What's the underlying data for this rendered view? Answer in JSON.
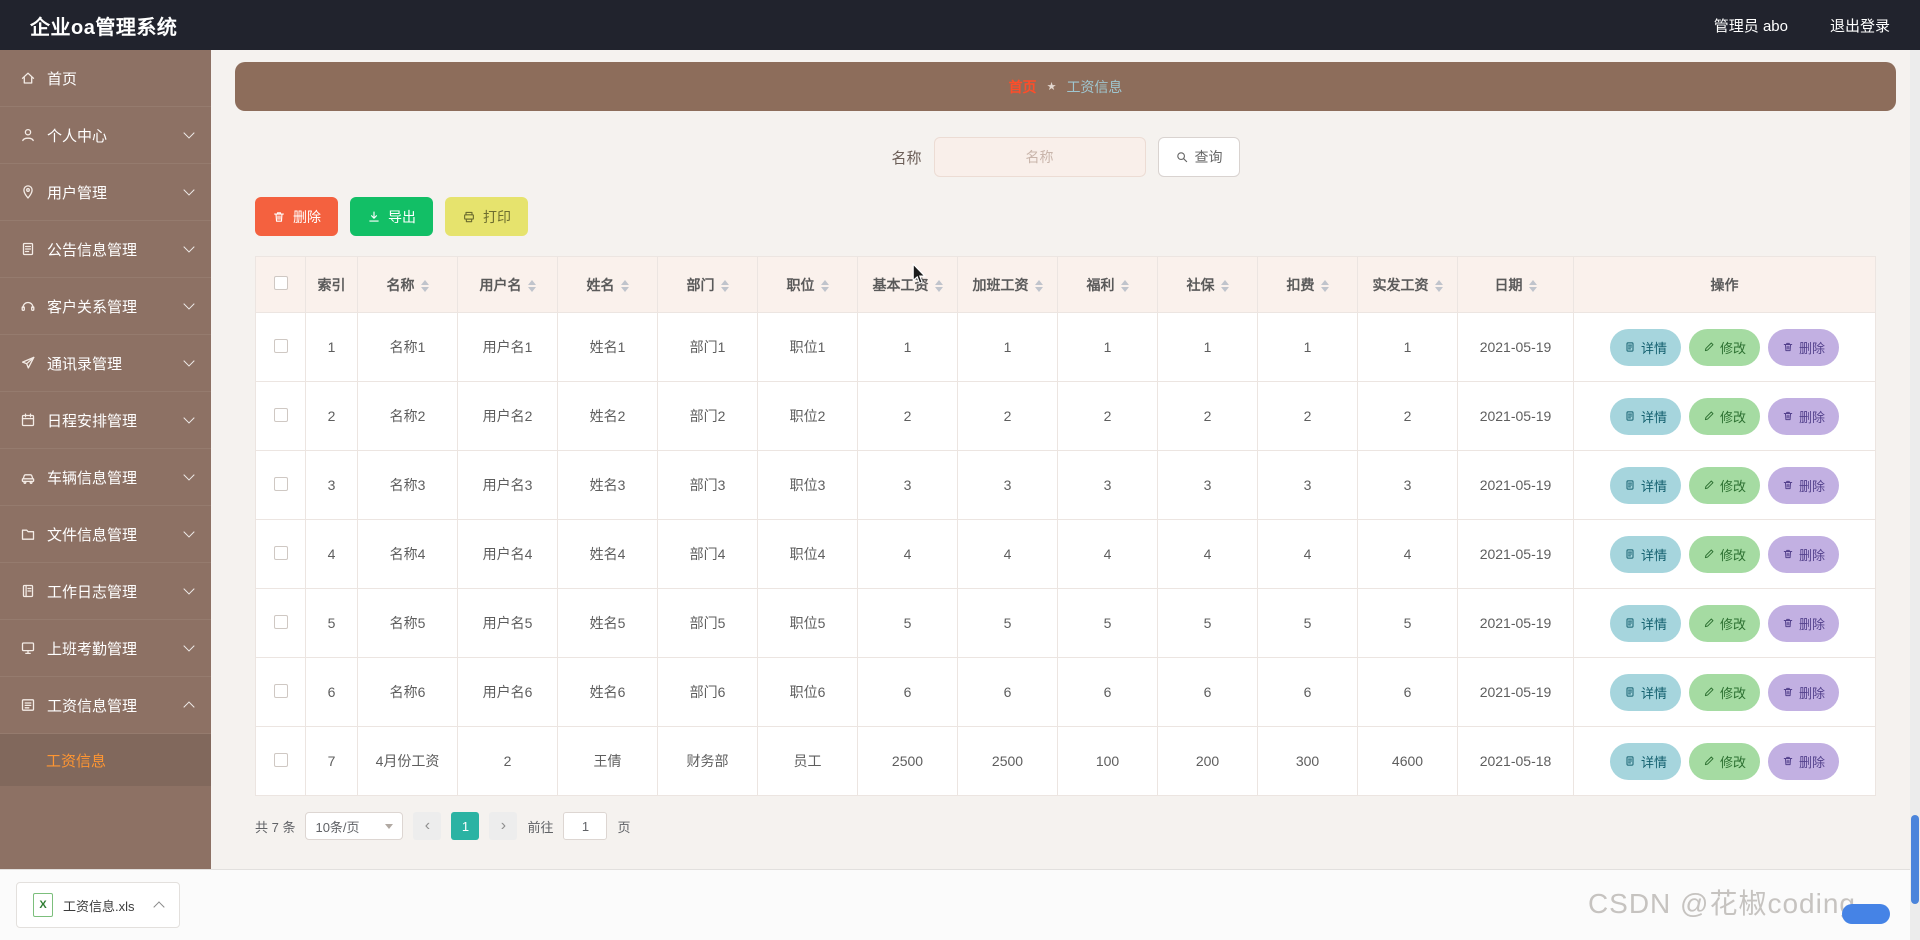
{
  "theme": {
    "header_bg": "#21232d",
    "sidebar_bg": "#8d7164",
    "submenu_active": "#ff9632",
    "breadcrumb_bg": "#8d6d5b",
    "breadcrumb_home": "#ff4d29",
    "breadcrumb_current": "#9fc6d0",
    "page_bg": "#f5f2ef",
    "table_header_bg": "#faf1ec",
    "table_border": "#ece5e1",
    "delete_btn": "#f4613f",
    "export_btn": "#12bf66",
    "print_btn_bg": "#e6e36d",
    "print_btn_text": "#6d6d2f",
    "detail_pill_bg": "#a6d5dd",
    "detail_pill_text": "#135f6e",
    "edit_pill_bg": "#a5dba2",
    "edit_pill_text": "#2c7031",
    "remove_pill_bg": "#c2b0e2",
    "remove_pill_text": "#53418c",
    "pagination_active": "#2bb3a3",
    "scrollbar_thumb": "#4a84db"
  },
  "header": {
    "title": "企业oa管理系统",
    "user": "管理员 abo",
    "logout": "退出登录"
  },
  "sidebar": {
    "items": [
      {
        "key": "home",
        "label": "首页",
        "icon": "home-icon",
        "expandable": false
      },
      {
        "key": "personal-center",
        "label": "个人中心",
        "icon": "user-icon",
        "expandable": true
      },
      {
        "key": "user-management",
        "label": "用户管理",
        "icon": "users-icon",
        "expandable": true
      },
      {
        "key": "announcement-management",
        "label": "公告信息管理",
        "icon": "announcement-icon",
        "expandable": true
      },
      {
        "key": "customer-relation-management",
        "label": "客户关系管理",
        "icon": "customer-icon",
        "expandable": true
      },
      {
        "key": "contacts-management",
        "label": "通讯录管理",
        "icon": "contacts-icon",
        "expandable": true
      },
      {
        "key": "schedule-management",
        "label": "日程安排管理",
        "icon": "schedule-icon",
        "expandable": true
      },
      {
        "key": "vehicle-management",
        "label": "车辆信息管理",
        "icon": "vehicle-icon",
        "expandable": true
      },
      {
        "key": "file-management",
        "label": "文件信息管理",
        "icon": "file-icon",
        "expandable": true
      },
      {
        "key": "worklog-management",
        "label": "工作日志管理",
        "icon": "worklog-icon",
        "expandable": true
      },
      {
        "key": "attendance-management",
        "label": "上班考勤管理",
        "icon": "attendance-icon",
        "expandable": true
      },
      {
        "key": "salary-management",
        "label": "工资信息管理",
        "icon": "salary-icon",
        "expandable": true,
        "expanded": true,
        "children": [
          {
            "key": "salary-info",
            "label": "工资信息",
            "active": true
          }
        ]
      }
    ]
  },
  "breadcrumb": {
    "home": "首页",
    "separator": "★",
    "current": "工资信息"
  },
  "search": {
    "label": "名称",
    "placeholder": "名称",
    "button": "查询"
  },
  "toolbar": {
    "delete": "删除",
    "export": "导出",
    "print": "打印"
  },
  "table": {
    "columns": [
      {
        "label": "索引",
        "key": "index",
        "field": "index",
        "sortable": false
      },
      {
        "label": "名称",
        "key": "name",
        "field": "name",
        "sortable": true
      },
      {
        "label": "用户名",
        "key": "username",
        "field": "username",
        "sortable": true
      },
      {
        "label": "姓名",
        "key": "realname",
        "field": "realname",
        "sortable": true
      },
      {
        "label": "部门",
        "key": "department",
        "field": "department",
        "sortable": true
      },
      {
        "label": "职位",
        "key": "position",
        "field": "position",
        "sortable": true
      },
      {
        "label": "基本工资",
        "key": "base-salary",
        "field": "base_salary",
        "sortable": true
      },
      {
        "label": "加班工资",
        "key": "overtime-pay",
        "field": "overtime_pay",
        "sortable": true
      },
      {
        "label": "福利",
        "key": "welfare",
        "field": "welfare",
        "sortable": true
      },
      {
        "label": "社保",
        "key": "social-security",
        "field": "social_security",
        "sortable": true
      },
      {
        "label": "扣费",
        "key": "deduction",
        "field": "deduction",
        "sortable": true
      },
      {
        "label": "实发工资",
        "key": "actual-pay",
        "field": "actual_pay",
        "sortable": true
      },
      {
        "label": "日期",
        "key": "date",
        "field": "date",
        "sortable": true
      },
      {
        "label": "操作",
        "key": "actions",
        "field": null,
        "sortable": false
      }
    ],
    "rows": [
      {
        "index": "1",
        "name": "名称1",
        "username": "用户名1",
        "realname": "姓名1",
        "department": "部门1",
        "position": "职位1",
        "base_salary": "1",
        "overtime_pay": "1",
        "welfare": "1",
        "social_security": "1",
        "deduction": "1",
        "actual_pay": "1",
        "date": "2021-05-19"
      },
      {
        "index": "2",
        "name": "名称2",
        "username": "用户名2",
        "realname": "姓名2",
        "department": "部门2",
        "position": "职位2",
        "base_salary": "2",
        "overtime_pay": "2",
        "welfare": "2",
        "social_security": "2",
        "deduction": "2",
        "actual_pay": "2",
        "date": "2021-05-19"
      },
      {
        "index": "3",
        "name": "名称3",
        "username": "用户名3",
        "realname": "姓名3",
        "department": "部门3",
        "position": "职位3",
        "base_salary": "3",
        "overtime_pay": "3",
        "welfare": "3",
        "social_security": "3",
        "deduction": "3",
        "actual_pay": "3",
        "date": "2021-05-19"
      },
      {
        "index": "4",
        "name": "名称4",
        "username": "用户名4",
        "realname": "姓名4",
        "department": "部门4",
        "position": "职位4",
        "base_salary": "4",
        "overtime_pay": "4",
        "welfare": "4",
        "social_security": "4",
        "deduction": "4",
        "actual_pay": "4",
        "date": "2021-05-19"
      },
      {
        "index": "5",
        "name": "名称5",
        "username": "用户名5",
        "realname": "姓名5",
        "department": "部门5",
        "position": "职位5",
        "base_salary": "5",
        "overtime_pay": "5",
        "welfare": "5",
        "social_security": "5",
        "deduction": "5",
        "actual_pay": "5",
        "date": "2021-05-19"
      },
      {
        "index": "6",
        "name": "名称6",
        "username": "用户名6",
        "realname": "姓名6",
        "department": "部门6",
        "position": "职位6",
        "base_salary": "6",
        "overtime_pay": "6",
        "welfare": "6",
        "social_security": "6",
        "deduction": "6",
        "actual_pay": "6",
        "date": "2021-05-19"
      },
      {
        "index": "7",
        "name": "4月份工资",
        "username": "2",
        "realname": "王倩",
        "department": "财务部",
        "position": "员工",
        "base_salary": "2500",
        "overtime_pay": "2500",
        "welfare": "100",
        "social_security": "200",
        "deduction": "300",
        "actual_pay": "4600",
        "date": "2021-05-18"
      }
    ],
    "actions": {
      "detail": "详情",
      "edit": "修改",
      "delete": "删除"
    }
  },
  "pagination": {
    "total": "共 7 条",
    "page_size": "10条/页",
    "prev_icon": "‹",
    "next_icon": "›",
    "current_page": "1",
    "goto_label": "前往",
    "goto_value": "1",
    "page_label": "页"
  },
  "download_bar": {
    "filename": "工资信息.xls",
    "file_type": "X"
  },
  "watermark": "CSDN @花椒coding"
}
